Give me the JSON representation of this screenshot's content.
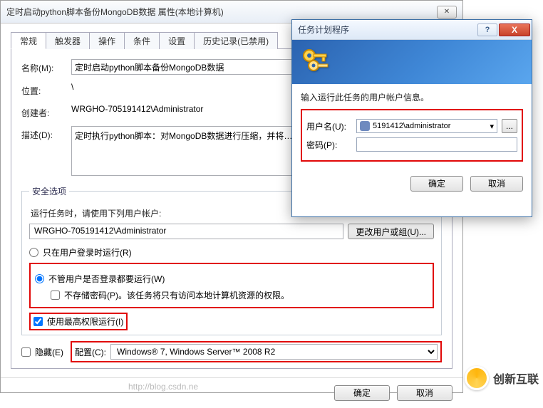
{
  "main_window": {
    "title": "定时启动python脚本备份MongoDB数据 属性(本地计算机)",
    "close_glyph": "✕"
  },
  "tabs": {
    "general": "常规",
    "triggers": "触发器",
    "actions": "操作",
    "conditions": "条件",
    "settings": "设置",
    "history": "历史记录(已禁用)"
  },
  "general": {
    "name_label": "名称(M):",
    "name_value": "定时启动python脚本备份MongoDB数据",
    "location_label": "位置:",
    "location_value": "\\",
    "author_label": "创建者:",
    "author_value": "WRGHO-705191412\\Administrator",
    "desc_label": "描述(D):",
    "desc_value": "定时执行python脚本：对MongoDB数据进行压缩，并将……"
  },
  "security": {
    "legend": "安全选项",
    "prompt": "运行任务时，请使用下列用户帐户:",
    "account": "WRGHO-705191412\\Administrator",
    "change_btn": "更改用户或组(U)...",
    "radio_logged_on": "只在用户登录时运行(R)",
    "radio_any": "不管用户是否登录都要运行(W)",
    "check_nopwd": "不存储密码(P)。该任务将只有访问本地计算机资源的权限。",
    "check_highest": "使用最高权限运行(I)"
  },
  "bottom": {
    "hidden_label": "隐藏(E)",
    "config_label": "配置(C):",
    "config_value": "Windows® 7, Windows Server™ 2008 R2"
  },
  "main_buttons": {
    "ok": "确定",
    "cancel": "取消"
  },
  "cred": {
    "title": "任务计划程序",
    "help_glyph": "?",
    "close_glyph": "X",
    "prompt": "输入运行此任务的用户帐户信息。",
    "user_label": "用户名(U):",
    "user_value": "5191412\\administrator",
    "pwd_label": "密码(P):",
    "browse_glyph": "...",
    "ok": "确定",
    "cancel": "取消"
  },
  "watermark": {
    "text": "创新互联",
    "url": "http://blog.csdn.ne"
  }
}
